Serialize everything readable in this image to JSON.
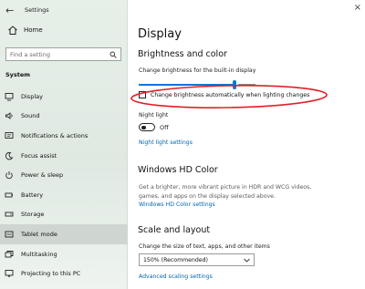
{
  "window": {
    "title": "Settings",
    "back_glyph": "←"
  },
  "sidebar": {
    "home_label": "Home",
    "search_placeholder": "Find a setting",
    "section": "System",
    "items": [
      {
        "label": "Display",
        "icon": "monitor-icon"
      },
      {
        "label": "Sound",
        "icon": "speaker-icon"
      },
      {
        "label": "Notifications & actions",
        "icon": "notifications-icon"
      },
      {
        "label": "Focus assist",
        "icon": "moon-icon"
      },
      {
        "label": "Power & sleep",
        "icon": "power-icon"
      },
      {
        "label": "Battery",
        "icon": "battery-icon"
      },
      {
        "label": "Storage",
        "icon": "storage-icon"
      },
      {
        "label": "Tablet mode",
        "icon": "tablet-icon",
        "active": true
      },
      {
        "label": "Multitasking",
        "icon": "multitasking-icon"
      },
      {
        "label": "Projecting to this PC",
        "icon": "projecting-icon"
      }
    ]
  },
  "main": {
    "window_control": "×",
    "title": "Display",
    "brightness": {
      "heading": "Brightness and color",
      "slider_label": "Change brightness for the built-in display",
      "slider_value": 0.82,
      "auto_checkbox_label": "Change brightness automatically when lighting changes",
      "auto_checked": false,
      "night_light_label": "Night light",
      "night_light_state": "Off",
      "night_light_link": "Night light settings"
    },
    "hdr": {
      "heading": "Windows HD Color",
      "description": "Get a brighter, more vibrant picture in HDR and WCG videos, games, and apps on the display selected above.",
      "link": "Windows HD Color settings"
    },
    "scale": {
      "heading": "Scale and layout",
      "label": "Change the size of text, apps, and other items",
      "selected": "150% (Recommended)",
      "link": "Advanced scaling settings"
    }
  },
  "colors": {
    "accent": "#0078d7",
    "link": "#0063b1",
    "annotation": "#e0202a"
  }
}
